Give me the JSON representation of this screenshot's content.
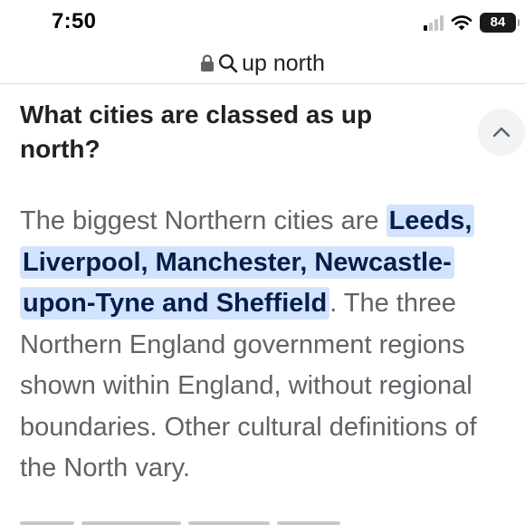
{
  "status_bar": {
    "time": "7:50",
    "battery_level": "84",
    "signal_bars_total": 4,
    "signal_bars_filled": 1
  },
  "url_bar": {
    "query": "up north",
    "lock_icon": "lock-icon",
    "search_icon": "search-icon"
  },
  "accordion": {
    "question": "What cities are classed as up north?",
    "collapse_icon": "chevron-up-icon",
    "answer": {
      "text_before": "The biggest Northern cities are ",
      "highlight": "Leeds, Liverpool, Manchester, Newcastle-upon-Tyne and Sheffield",
      "text_after": ". The three Northern England government regions shown within England, without regional boundaries. Other cultural definitions of the North vary."
    }
  },
  "colors": {
    "highlight_bg": "#d3e3fd",
    "highlight_text": "#041e49",
    "body_text": "#5f6368",
    "heading_text": "#202124",
    "button_bg": "#f1f3f4"
  }
}
